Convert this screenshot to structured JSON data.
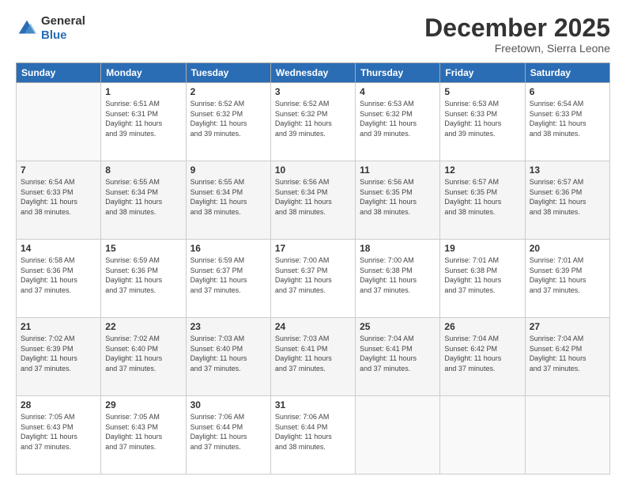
{
  "header": {
    "logo_general": "General",
    "logo_blue": "Blue",
    "month_title": "December 2025",
    "subtitle": "Freetown, Sierra Leone"
  },
  "days_of_week": [
    "Sunday",
    "Monday",
    "Tuesday",
    "Wednesday",
    "Thursday",
    "Friday",
    "Saturday"
  ],
  "weeks": [
    [
      {
        "day": "",
        "info": ""
      },
      {
        "day": "1",
        "info": "Sunrise: 6:51 AM\nSunset: 6:31 PM\nDaylight: 11 hours\nand 39 minutes."
      },
      {
        "day": "2",
        "info": "Sunrise: 6:52 AM\nSunset: 6:32 PM\nDaylight: 11 hours\nand 39 minutes."
      },
      {
        "day": "3",
        "info": "Sunrise: 6:52 AM\nSunset: 6:32 PM\nDaylight: 11 hours\nand 39 minutes."
      },
      {
        "day": "4",
        "info": "Sunrise: 6:53 AM\nSunset: 6:32 PM\nDaylight: 11 hours\nand 39 minutes."
      },
      {
        "day": "5",
        "info": "Sunrise: 6:53 AM\nSunset: 6:33 PM\nDaylight: 11 hours\nand 39 minutes."
      },
      {
        "day": "6",
        "info": "Sunrise: 6:54 AM\nSunset: 6:33 PM\nDaylight: 11 hours\nand 38 minutes."
      }
    ],
    [
      {
        "day": "7",
        "info": "Sunrise: 6:54 AM\nSunset: 6:33 PM\nDaylight: 11 hours\nand 38 minutes."
      },
      {
        "day": "8",
        "info": "Sunrise: 6:55 AM\nSunset: 6:34 PM\nDaylight: 11 hours\nand 38 minutes."
      },
      {
        "day": "9",
        "info": "Sunrise: 6:55 AM\nSunset: 6:34 PM\nDaylight: 11 hours\nand 38 minutes."
      },
      {
        "day": "10",
        "info": "Sunrise: 6:56 AM\nSunset: 6:34 PM\nDaylight: 11 hours\nand 38 minutes."
      },
      {
        "day": "11",
        "info": "Sunrise: 6:56 AM\nSunset: 6:35 PM\nDaylight: 11 hours\nand 38 minutes."
      },
      {
        "day": "12",
        "info": "Sunrise: 6:57 AM\nSunset: 6:35 PM\nDaylight: 11 hours\nand 38 minutes."
      },
      {
        "day": "13",
        "info": "Sunrise: 6:57 AM\nSunset: 6:36 PM\nDaylight: 11 hours\nand 38 minutes."
      }
    ],
    [
      {
        "day": "14",
        "info": "Sunrise: 6:58 AM\nSunset: 6:36 PM\nDaylight: 11 hours\nand 37 minutes."
      },
      {
        "day": "15",
        "info": "Sunrise: 6:59 AM\nSunset: 6:36 PM\nDaylight: 11 hours\nand 37 minutes."
      },
      {
        "day": "16",
        "info": "Sunrise: 6:59 AM\nSunset: 6:37 PM\nDaylight: 11 hours\nand 37 minutes."
      },
      {
        "day": "17",
        "info": "Sunrise: 7:00 AM\nSunset: 6:37 PM\nDaylight: 11 hours\nand 37 minutes."
      },
      {
        "day": "18",
        "info": "Sunrise: 7:00 AM\nSunset: 6:38 PM\nDaylight: 11 hours\nand 37 minutes."
      },
      {
        "day": "19",
        "info": "Sunrise: 7:01 AM\nSunset: 6:38 PM\nDaylight: 11 hours\nand 37 minutes."
      },
      {
        "day": "20",
        "info": "Sunrise: 7:01 AM\nSunset: 6:39 PM\nDaylight: 11 hours\nand 37 minutes."
      }
    ],
    [
      {
        "day": "21",
        "info": "Sunrise: 7:02 AM\nSunset: 6:39 PM\nDaylight: 11 hours\nand 37 minutes."
      },
      {
        "day": "22",
        "info": "Sunrise: 7:02 AM\nSunset: 6:40 PM\nDaylight: 11 hours\nand 37 minutes."
      },
      {
        "day": "23",
        "info": "Sunrise: 7:03 AM\nSunset: 6:40 PM\nDaylight: 11 hours\nand 37 minutes."
      },
      {
        "day": "24",
        "info": "Sunrise: 7:03 AM\nSunset: 6:41 PM\nDaylight: 11 hours\nand 37 minutes."
      },
      {
        "day": "25",
        "info": "Sunrise: 7:04 AM\nSunset: 6:41 PM\nDaylight: 11 hours\nand 37 minutes."
      },
      {
        "day": "26",
        "info": "Sunrise: 7:04 AM\nSunset: 6:42 PM\nDaylight: 11 hours\nand 37 minutes."
      },
      {
        "day": "27",
        "info": "Sunrise: 7:04 AM\nSunset: 6:42 PM\nDaylight: 11 hours\nand 37 minutes."
      }
    ],
    [
      {
        "day": "28",
        "info": "Sunrise: 7:05 AM\nSunset: 6:43 PM\nDaylight: 11 hours\nand 37 minutes."
      },
      {
        "day": "29",
        "info": "Sunrise: 7:05 AM\nSunset: 6:43 PM\nDaylight: 11 hours\nand 37 minutes."
      },
      {
        "day": "30",
        "info": "Sunrise: 7:06 AM\nSunset: 6:44 PM\nDaylight: 11 hours\nand 37 minutes."
      },
      {
        "day": "31",
        "info": "Sunrise: 7:06 AM\nSunset: 6:44 PM\nDaylight: 11 hours\nand 38 minutes."
      },
      {
        "day": "",
        "info": ""
      },
      {
        "day": "",
        "info": ""
      },
      {
        "day": "",
        "info": ""
      }
    ]
  ]
}
